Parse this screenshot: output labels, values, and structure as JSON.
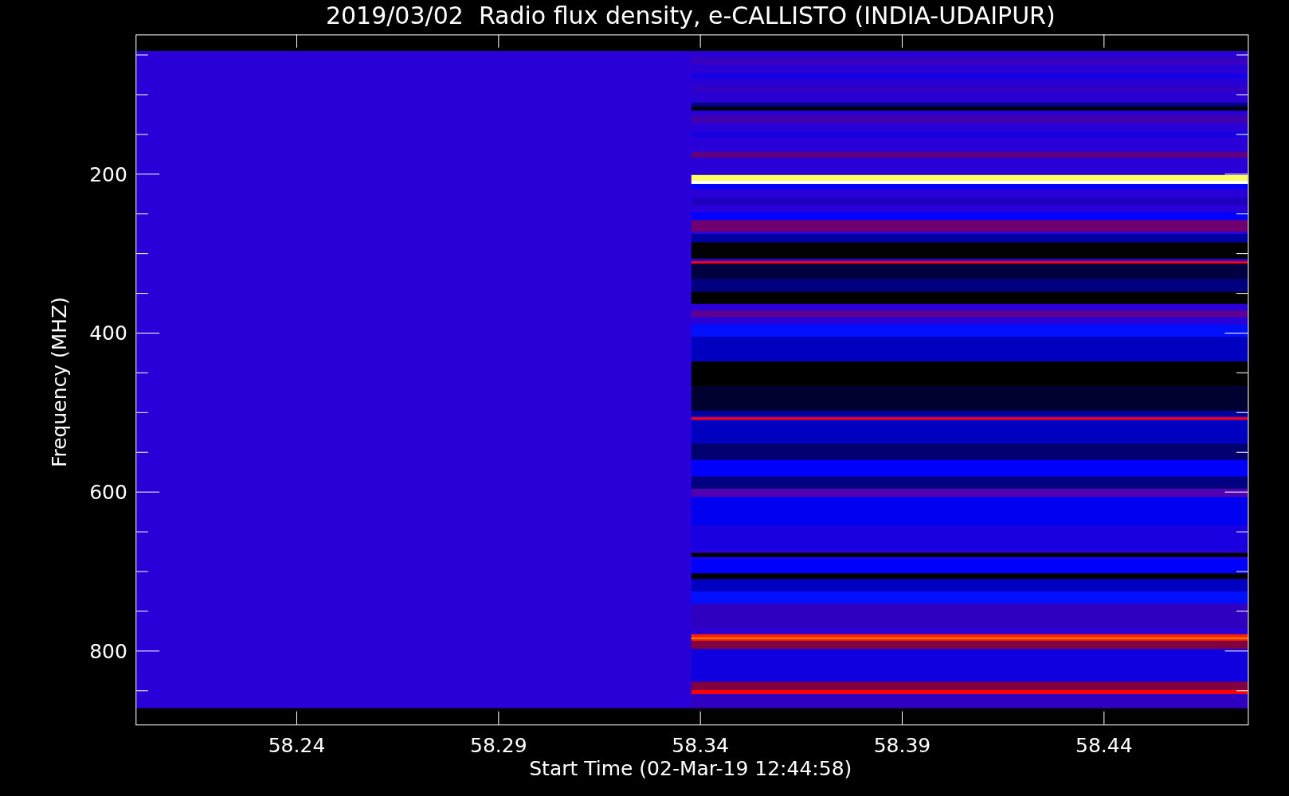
{
  "title": "2019/03/02  Radio flux density, e-CALLISTO (INDIA-UDAIPUR)",
  "y_axis": {
    "label": "Frequency (MHZ)",
    "ticks": [
      "200",
      "400",
      "600",
      "800"
    ]
  },
  "x_axis": {
    "label": "Start Time (02-Mar-19 12:44:58)",
    "ticks": [
      "58.24",
      "58.29",
      "58.34",
      "58.39",
      "58.44"
    ]
  }
}
